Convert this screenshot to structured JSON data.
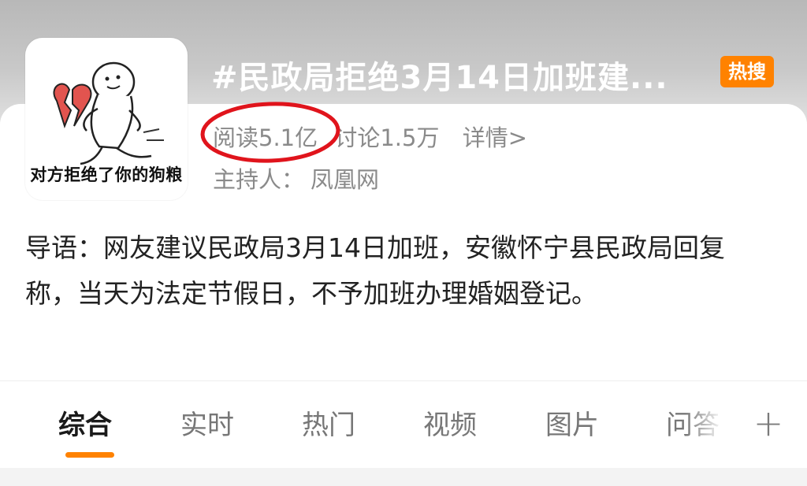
{
  "topic": {
    "title": "#民政局拒绝3月14日加班建...",
    "hot_badge": "热搜",
    "avatar_caption": "对方拒绝了你的狗粮",
    "read_count": "阅读5.1亿",
    "discuss_count": "讨论1.5万",
    "detail_link": "详情>",
    "host_label": "主持人：",
    "host_name": "凤凰网"
  },
  "intro": {
    "text": "导语：网友建议民政局3月14日加班，安徽怀宁县民政局回复称，当天为法定节假日，不予加班办理婚姻登记。"
  },
  "tabs": {
    "items": [
      {
        "label": "综合",
        "active": true
      },
      {
        "label": "实时",
        "active": false
      },
      {
        "label": "热门",
        "active": false
      },
      {
        "label": "视频",
        "active": false
      },
      {
        "label": "图片",
        "active": false
      },
      {
        "label": "问答",
        "active": false
      }
    ],
    "add_icon": "plus-icon"
  },
  "colors": {
    "accent": "#ff8200",
    "annotation_circle": "#e0141c",
    "meta_text": "#8a8a8a"
  }
}
